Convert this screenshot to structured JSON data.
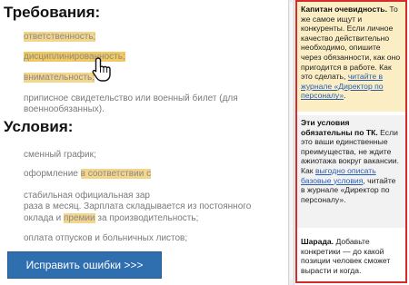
{
  "requirements": {
    "title": "Требования:",
    "items": [
      "ответственность;",
      "дисциплинированность;",
      "внимательность;"
    ],
    "note_line1": "приписное свидетельство или военный билет (для",
    "note_line2": "военнообязанных)."
  },
  "conditions": {
    "title": "Условия:",
    "schedule": "сменный график;",
    "formal_pre": "оформление ",
    "formal_hl": "в соответствии с",
    "salary_line1": "стабильная официальная зар",
    "salary_line2": "раза в месяц. Зарплата складывается из постоянного",
    "salary_line3_pre": "оклада и ",
    "salary_line3_hl": "премии",
    "salary_line3_post": " за производительность;",
    "leave": "оплата отпусков и больничных листов;"
  },
  "fix_button": {
    "label": "Исправить ошибки >>>"
  },
  "panel": {
    "block1": {
      "bold": "Капитан очевидность.",
      "text": " То же самое ищут и конкуренты. Если личное качество действительно необходимо, опишите через обязанности, как оно пригодится в работе. Как это сделать, ",
      "link": "читайте в журнале «Директор по персоналу»",
      "end": "."
    },
    "block2": {
      "bold": "Эти условия обязательны по ТК.",
      "text": " Если это ваши единственные преимущества, не ждите ажиотажа вокруг вакансии. Как ",
      "link": "выгодно описать базовые условия",
      "end": ", читайте в журнале «Директор по персоналу»."
    },
    "block3": {
      "bold": "Шарада.",
      "text": " Добавьте конкретики — до какой позиции человек сможет вырасти и когда."
    }
  },
  "colors": {
    "highlight": "#f3d58c",
    "button": "#2f6fb0",
    "panel_border": "#d62b2b",
    "link": "#2a5db0"
  }
}
